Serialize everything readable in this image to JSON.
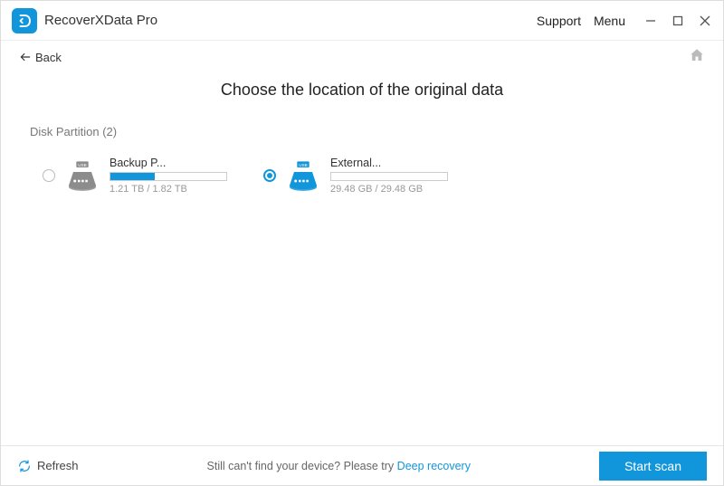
{
  "app": {
    "title": "RecoverXData Pro"
  },
  "titlebar": {
    "support": "Support",
    "menu": "Menu"
  },
  "nav": {
    "back": "Back"
  },
  "main": {
    "heading": "Choose the location of the original data",
    "section_label": "Disk Partition  (2)"
  },
  "partitions": [
    {
      "name": "Backup P...",
      "size": "1.21 TB / 1.82 TB",
      "fill_percent": 38,
      "selected": false,
      "icon_color": "#8c8c8c"
    },
    {
      "name": "External...",
      "size": "29.48 GB / 29.48 GB",
      "fill_percent": 0,
      "selected": true,
      "icon_color": "#1296db"
    }
  ],
  "footer": {
    "refresh": "Refresh",
    "hint_prefix": "Still can't find your device? Please try ",
    "hint_link": "Deep recovery",
    "start": "Start scan"
  },
  "colors": {
    "accent": "#1296db"
  }
}
